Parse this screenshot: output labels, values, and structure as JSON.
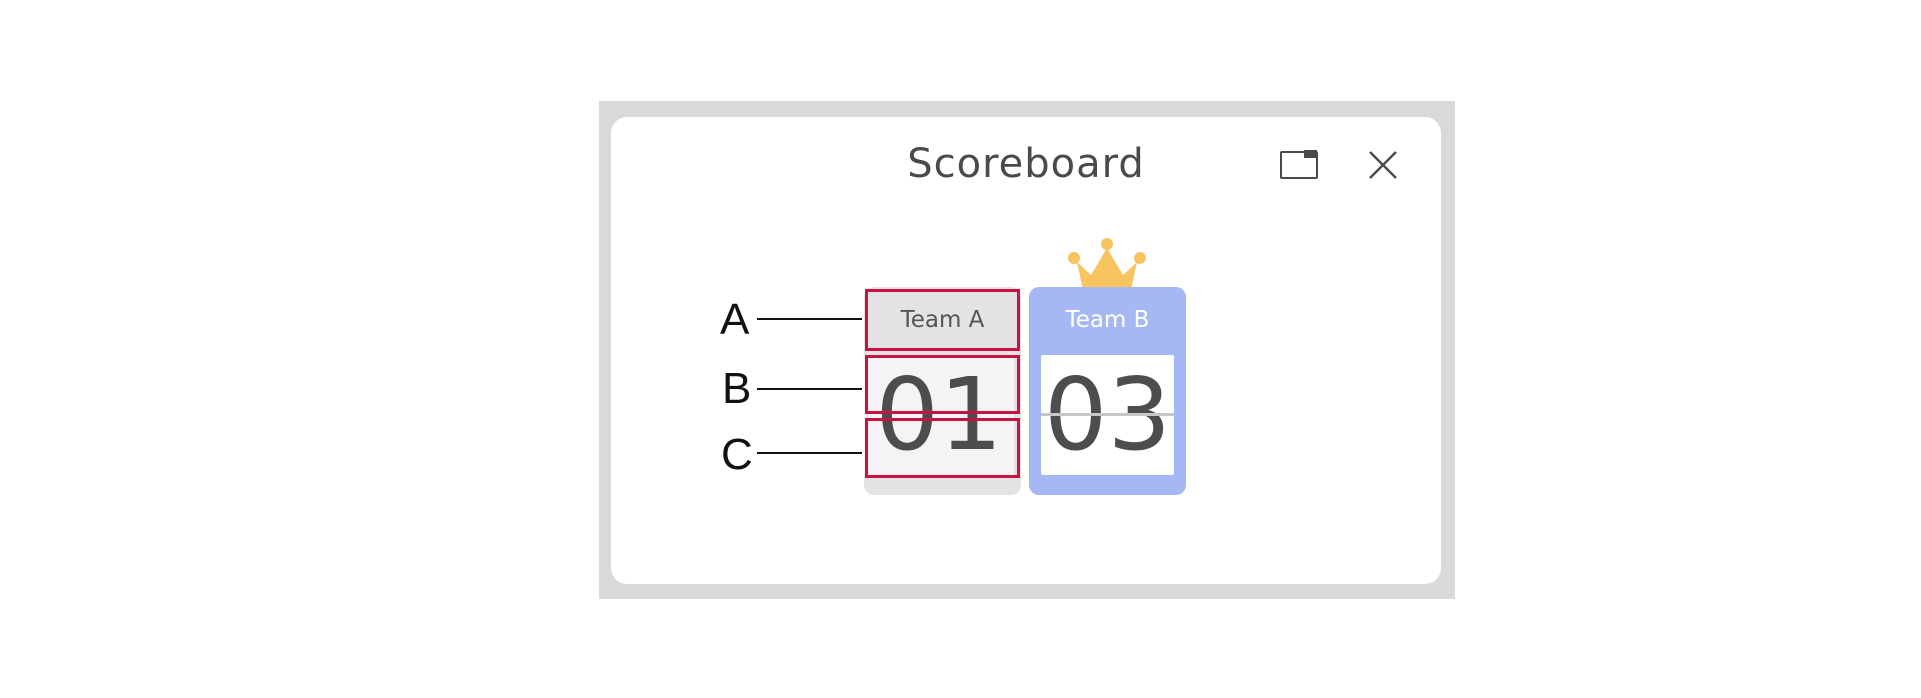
{
  "dialog": {
    "title": "Scoreboard"
  },
  "teams": [
    {
      "name": "Team A",
      "score": "01"
    },
    {
      "name": "Team B",
      "score": "03",
      "leader": true
    }
  ],
  "callouts": {
    "a": "A",
    "b": "B",
    "c": "C"
  },
  "colors": {
    "team_b_accent": "#a6b8f3",
    "crown": "#f8c45f",
    "highlight": "#c8133f"
  },
  "icons": {
    "pip": "picture-in-picture-icon",
    "close": "close-icon",
    "crown": "crown-icon"
  }
}
